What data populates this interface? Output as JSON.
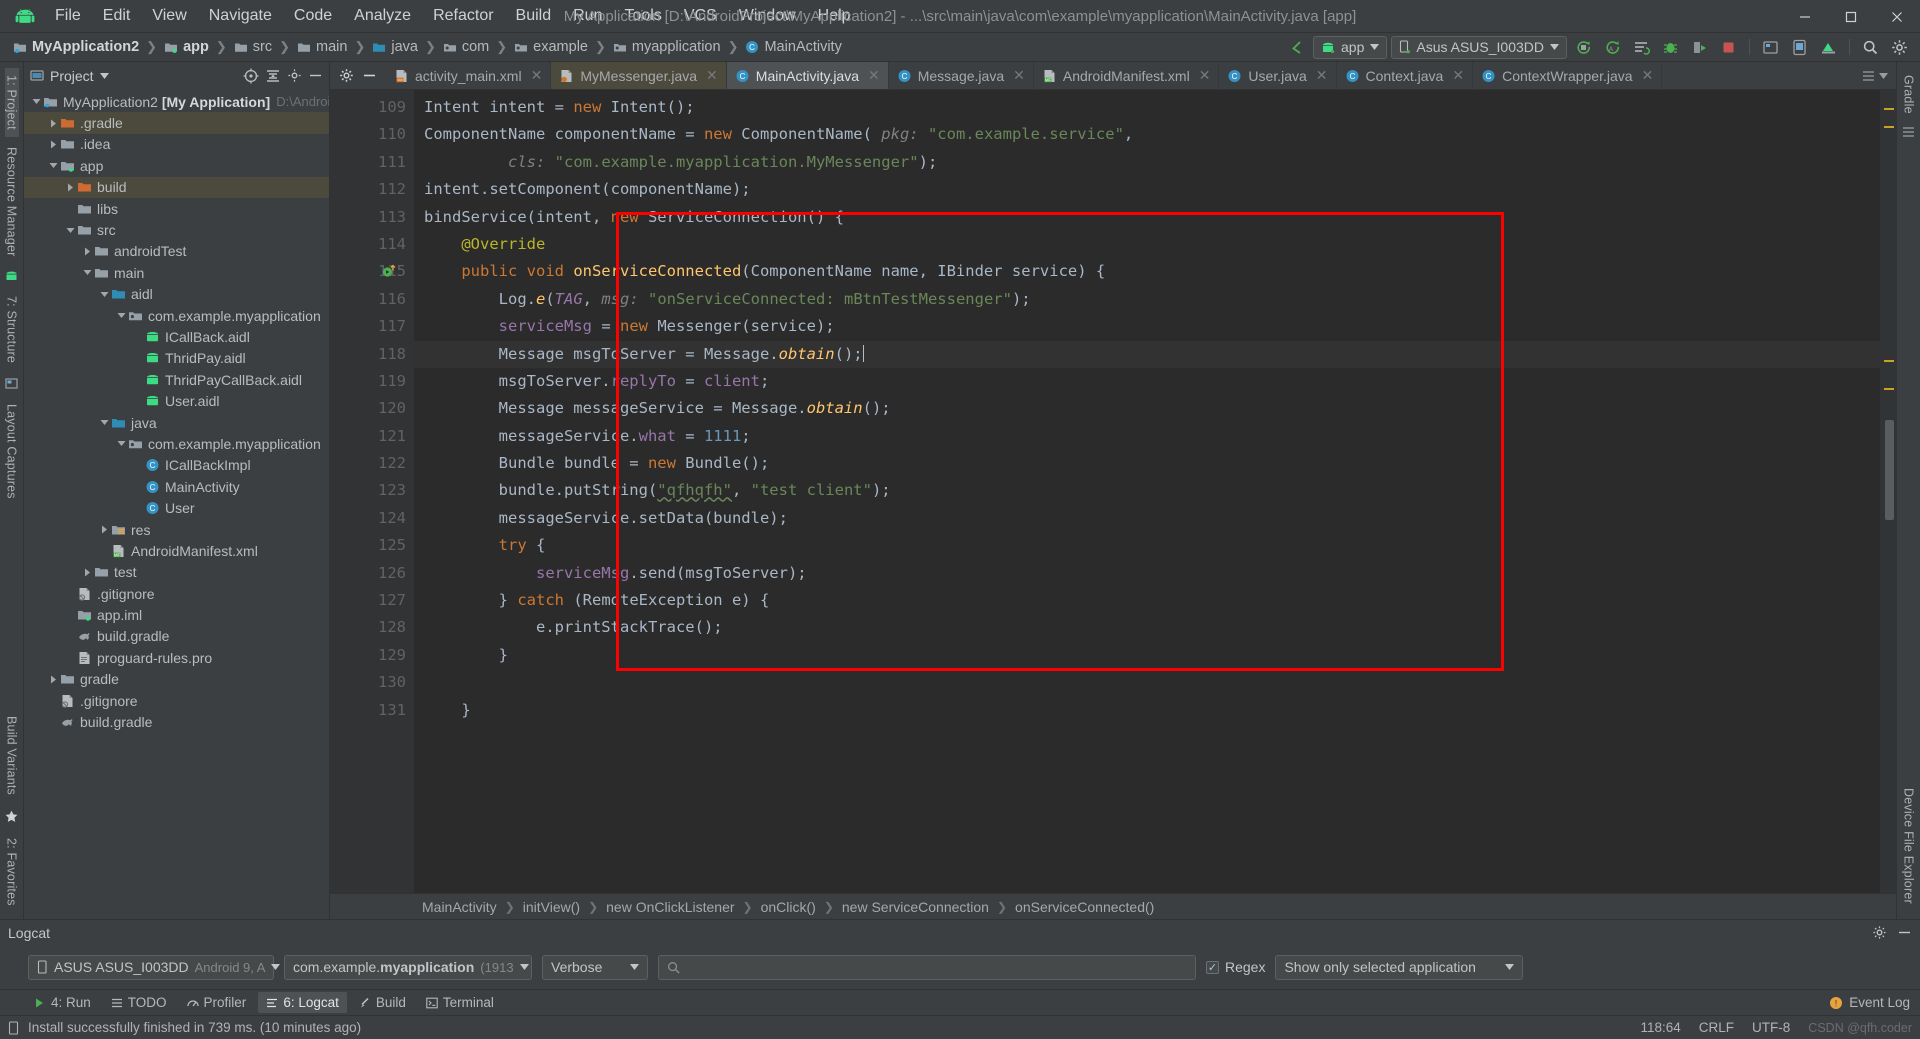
{
  "window": {
    "title": "My Application [D:\\AndroidProject\\MyApplication2] - ...\\src\\main\\java\\com\\example\\myapplication\\MainActivity.java [app]",
    "minimize": "—",
    "maximize": "❐",
    "close": "✕"
  },
  "menu": [
    {
      "label": "File"
    },
    {
      "label": "Edit"
    },
    {
      "label": "View"
    },
    {
      "label": "Navigate"
    },
    {
      "label": "Code"
    },
    {
      "label": "Analyze"
    },
    {
      "label": "Refactor"
    },
    {
      "label": "Build"
    },
    {
      "label": "Run"
    },
    {
      "label": "Tools"
    },
    {
      "label": "VCS"
    },
    {
      "label": "Window"
    },
    {
      "label": "Help"
    }
  ],
  "navbar": {
    "crumbs": [
      {
        "label": "MyApplication2",
        "icon": "project-folder-icon",
        "bold": true
      },
      {
        "label": "app",
        "icon": "module-folder-icon",
        "bold": true
      },
      {
        "label": "src",
        "icon": "folder-icon",
        "bold": false
      },
      {
        "label": "main",
        "icon": "folder-icon",
        "bold": false
      },
      {
        "label": "java",
        "icon": "source-folder-icon",
        "bold": false
      },
      {
        "label": "com",
        "icon": "package-icon",
        "bold": false
      },
      {
        "label": "example",
        "icon": "package-icon",
        "bold": false
      },
      {
        "label": "myapplication",
        "icon": "package-icon",
        "bold": false
      },
      {
        "label": "MainActivity",
        "icon": "class-icon",
        "bold": false
      }
    ],
    "run_config": "app",
    "device": "Asus ASUS_I003DD",
    "icons": [
      "back-arrow-icon",
      "run-icon",
      "debug-with-coverage-icon",
      "run-with-profiler-icon",
      "debug-icon",
      "attach-debugger-icon",
      "stop-icon",
      "layout-inspector-icon",
      "avd-manager-icon",
      "sdk-manager-icon",
      "search-icon",
      "settings-icon"
    ]
  },
  "left_rail": [
    {
      "label": "1: Project",
      "active": true
    },
    {
      "label": "Resource Manager",
      "active": false
    },
    {
      "label": "7: Structure",
      "active": false
    },
    {
      "label": "Layout Captures",
      "active": false
    },
    {
      "label": "Build Variants",
      "active": false
    },
    {
      "label": "2: Favorites",
      "active": false
    }
  ],
  "right_rail": [
    {
      "label": "Gradle"
    },
    {
      "label": "Device File Explorer"
    }
  ],
  "project_panel": {
    "title": "Project",
    "actions": [
      "target-icon",
      "collapse-all-icon",
      "settings-icon",
      "hide-icon"
    ],
    "tree": [
      {
        "depth": 0,
        "arrow": "down",
        "icon": "project-folder-icon",
        "label": "MyApplication2",
        "bold_suffix": "[My Application]",
        "sub": "D:\\Androi",
        "selected": false
      },
      {
        "depth": 1,
        "arrow": "right",
        "icon": "excluded-folder-icon",
        "label": ".gradle",
        "selected": true
      },
      {
        "depth": 1,
        "arrow": "right",
        "icon": "folder-icon",
        "label": ".idea",
        "selected": false
      },
      {
        "depth": 1,
        "arrow": "down",
        "icon": "module-folder-icon",
        "label": "app",
        "selected": false
      },
      {
        "depth": 2,
        "arrow": "right",
        "icon": "excluded-folder-icon",
        "label": "build",
        "selected": true
      },
      {
        "depth": 2,
        "arrow": "none",
        "icon": "folder-icon",
        "label": "libs",
        "selected": false
      },
      {
        "depth": 2,
        "arrow": "down",
        "icon": "folder-icon",
        "label": "src",
        "selected": false
      },
      {
        "depth": 3,
        "arrow": "right",
        "icon": "folder-icon",
        "label": "androidTest",
        "selected": false
      },
      {
        "depth": 3,
        "arrow": "down",
        "icon": "folder-icon",
        "label": "main",
        "selected": false
      },
      {
        "depth": 4,
        "arrow": "down",
        "icon": "source-folder-icon",
        "label": "aidl",
        "selected": false
      },
      {
        "depth": 5,
        "arrow": "down",
        "icon": "package-icon",
        "label": "com.example.myapplication",
        "selected": false
      },
      {
        "depth": 6,
        "arrow": "none",
        "icon": "aidl-file-icon",
        "label": "ICallBack.aidl",
        "selected": false
      },
      {
        "depth": 6,
        "arrow": "none",
        "icon": "aidl-file-icon",
        "label": "ThridPay.aidl",
        "selected": false
      },
      {
        "depth": 6,
        "arrow": "none",
        "icon": "aidl-file-icon",
        "label": "ThridPayCallBack.aidl",
        "selected": false
      },
      {
        "depth": 6,
        "arrow": "none",
        "icon": "aidl-file-icon",
        "label": "User.aidl",
        "selected": false
      },
      {
        "depth": 4,
        "arrow": "down",
        "icon": "source-folder-icon",
        "label": "java",
        "selected": false
      },
      {
        "depth": 5,
        "arrow": "down",
        "icon": "package-icon",
        "label": "com.example.myapplication",
        "selected": false
      },
      {
        "depth": 6,
        "arrow": "none",
        "icon": "class-icon",
        "label": "ICallBackImpl",
        "selected": false
      },
      {
        "depth": 6,
        "arrow": "none",
        "icon": "class-icon",
        "label": "MainActivity",
        "selected": false
      },
      {
        "depth": 6,
        "arrow": "none",
        "icon": "class-icon",
        "label": "User",
        "selected": false
      },
      {
        "depth": 4,
        "arrow": "right",
        "icon": "res-folder-icon",
        "label": "res",
        "selected": false
      },
      {
        "depth": 4,
        "arrow": "none",
        "icon": "manifest-file-icon",
        "label": "AndroidManifest.xml",
        "selected": false
      },
      {
        "depth": 3,
        "arrow": "right",
        "icon": "folder-icon",
        "label": "test",
        "selected": false
      },
      {
        "depth": 2,
        "arrow": "none",
        "icon": "gitignore-file-icon",
        "label": ".gitignore",
        "selected": false
      },
      {
        "depth": 2,
        "arrow": "none",
        "icon": "iml-file-icon",
        "label": "app.iml",
        "selected": false
      },
      {
        "depth": 2,
        "arrow": "none",
        "icon": "gradle-file-icon",
        "label": "build.gradle",
        "selected": false
      },
      {
        "depth": 2,
        "arrow": "none",
        "icon": "text-file-icon",
        "label": "proguard-rules.pro",
        "selected": false
      },
      {
        "depth": 1,
        "arrow": "right",
        "icon": "folder-icon",
        "label": "gradle",
        "selected": false
      },
      {
        "depth": 1,
        "arrow": "none",
        "icon": "gitignore-file-icon",
        "label": ".gitignore",
        "selected": false
      },
      {
        "depth": 1,
        "arrow": "none",
        "icon": "gradle-file-icon",
        "label": "build.gradle",
        "selected": false
      }
    ]
  },
  "editor_tabs": [
    {
      "label": "activity_main.xml",
      "icon": "xml-layout-file-icon",
      "state": "normal"
    },
    {
      "label": "MyMessenger.java",
      "icon": "java-file-icon",
      "state": "modified"
    },
    {
      "label": "MainActivity.java",
      "icon": "class-icon",
      "state": "active"
    },
    {
      "label": "Message.java",
      "icon": "class-icon",
      "state": "normal"
    },
    {
      "label": "AndroidManifest.xml",
      "icon": "manifest-file-icon",
      "state": "normal"
    },
    {
      "label": "User.java",
      "icon": "class-icon",
      "state": "normal"
    },
    {
      "label": "Context.java",
      "icon": "class-icon",
      "state": "normal"
    },
    {
      "label": "ContextWrapper.java",
      "icon": "class-icon",
      "state": "normal"
    }
  ],
  "editor": {
    "first_line": 109,
    "current_line": 118,
    "lines": [
      {
        "n": 109,
        "fold": false,
        "run": false,
        "tokens": [
          {
            "t": "Intent intent = ",
            "c": "p"
          },
          {
            "t": "new ",
            "c": "k"
          },
          {
            "t": "Intent();",
            "c": "p"
          }
        ],
        "indent": 0
      },
      {
        "n": 110,
        "fold": false,
        "run": false,
        "tokens": [
          {
            "t": "ComponentName componentName = ",
            "c": "p"
          },
          {
            "t": "new ",
            "c": "k"
          },
          {
            "t": "ComponentName(",
            "c": "p"
          },
          {
            "t": " pkg: ",
            "c": "hint"
          },
          {
            "t": "\"com.example.service\"",
            "c": "s"
          },
          {
            "t": ",",
            "c": "p"
          }
        ],
        "indent": 0
      },
      {
        "n": 111,
        "fold": false,
        "run": false,
        "tokens": [
          {
            "t": "        ",
            "c": "p"
          },
          {
            "t": " cls: ",
            "c": "hint"
          },
          {
            "t": "\"com.example.myapplication.MyMessenger\"",
            "c": "s"
          },
          {
            "t": ");",
            "c": "p"
          }
        ],
        "indent": 0
      },
      {
        "n": 112,
        "fold": false,
        "run": false,
        "tokens": [
          {
            "t": "intent.setComponent(componentName);",
            "c": "p"
          }
        ],
        "indent": 0
      },
      {
        "n": 113,
        "fold": true,
        "run": false,
        "tokens": [
          {
            "t": "bindService(intent, ",
            "c": "p"
          },
          {
            "t": "new ",
            "c": "k"
          },
          {
            "t": "ServiceConnection() {",
            "c": "p"
          }
        ],
        "indent": 0
      },
      {
        "n": 114,
        "fold": false,
        "run": false,
        "tokens": [
          {
            "t": "    @Override",
            "c": "an"
          }
        ],
        "indent": 0
      },
      {
        "n": 115,
        "fold": false,
        "run": true,
        "tokens": [
          {
            "t": "    ",
            "c": "p"
          },
          {
            "t": "public void ",
            "c": "k"
          },
          {
            "t": "onServiceConnected",
            "c": "f"
          },
          {
            "t": "(ComponentName name, IBinder service) {",
            "c": "p"
          }
        ],
        "indent": 0
      },
      {
        "n": 116,
        "fold": false,
        "run": false,
        "tokens": [
          {
            "t": "        Log.",
            "c": "p"
          },
          {
            "t": "e",
            "c": "f it"
          },
          {
            "t": "(",
            "c": "p"
          },
          {
            "t": "TAG",
            "c": "fld it"
          },
          {
            "t": ",",
            "c": "p"
          },
          {
            "t": " msg: ",
            "c": "hint"
          },
          {
            "t": "\"onServiceConnected: mBtnTestMessenger\"",
            "c": "s"
          },
          {
            "t": ");",
            "c": "p"
          }
        ],
        "indent": 0
      },
      {
        "n": 117,
        "fold": false,
        "run": false,
        "tokens": [
          {
            "t": "        ",
            "c": "p"
          },
          {
            "t": "serviceMsg",
            "c": "fld"
          },
          {
            "t": " = ",
            "c": "p"
          },
          {
            "t": "new ",
            "c": "k"
          },
          {
            "t": "Messenger(service);",
            "c": "p"
          }
        ],
        "indent": 0
      },
      {
        "n": 118,
        "fold": false,
        "run": false,
        "tokens": [
          {
            "t": "        Message msgToServer = Message.",
            "c": "p"
          },
          {
            "t": "obtain",
            "c": "f it"
          },
          {
            "t": "();",
            "c": "p"
          }
        ],
        "indent": 0,
        "caret": true
      },
      {
        "n": 119,
        "fold": false,
        "run": false,
        "tokens": [
          {
            "t": "        msgToServer.",
            "c": "p"
          },
          {
            "t": "replyTo",
            "c": "fld"
          },
          {
            "t": " = ",
            "c": "p"
          },
          {
            "t": "client",
            "c": "fld"
          },
          {
            "t": ";",
            "c": "p"
          }
        ],
        "indent": 0
      },
      {
        "n": 120,
        "fold": false,
        "run": false,
        "tokens": [
          {
            "t": "        Message messageService = Message.",
            "c": "p"
          },
          {
            "t": "obtain",
            "c": "f it"
          },
          {
            "t": "();",
            "c": "p"
          }
        ],
        "indent": 0
      },
      {
        "n": 121,
        "fold": false,
        "run": false,
        "tokens": [
          {
            "t": "        messageService.",
            "c": "p"
          },
          {
            "t": "what",
            "c": "fld"
          },
          {
            "t": " = ",
            "c": "p"
          },
          {
            "t": "1111",
            "c": "n"
          },
          {
            "t": ";",
            "c": "p"
          }
        ],
        "indent": 0
      },
      {
        "n": 122,
        "fold": false,
        "run": false,
        "tokens": [
          {
            "t": "        Bundle bundle = ",
            "c": "p"
          },
          {
            "t": "new ",
            "c": "k"
          },
          {
            "t": "Bundle();",
            "c": "p"
          }
        ],
        "indent": 0
      },
      {
        "n": 123,
        "fold": false,
        "run": false,
        "tokens": [
          {
            "t": "        bundle.putString(",
            "c": "p"
          },
          {
            "t": "\"qfhqfh\"",
            "c": "s typo"
          },
          {
            "t": ", ",
            "c": "p"
          },
          {
            "t": "\"test client\"",
            "c": "s"
          },
          {
            "t": ");",
            "c": "p"
          }
        ],
        "indent": 0
      },
      {
        "n": 124,
        "fold": false,
        "run": false,
        "tokens": [
          {
            "t": "        messageService.setData(bundle);",
            "c": "p"
          }
        ],
        "indent": 0
      },
      {
        "n": 125,
        "fold": true,
        "run": false,
        "tokens": [
          {
            "t": "        ",
            "c": "p"
          },
          {
            "t": "try ",
            "c": "k"
          },
          {
            "t": "{",
            "c": "p"
          }
        ],
        "indent": 0
      },
      {
        "n": 126,
        "fold": false,
        "run": false,
        "tokens": [
          {
            "t": "            ",
            "c": "p"
          },
          {
            "t": "serviceMsg",
            "c": "fld"
          },
          {
            "t": ".send(msgToServer);",
            "c": "p"
          }
        ],
        "indent": 0
      },
      {
        "n": 127,
        "fold": true,
        "run": false,
        "tokens": [
          {
            "t": "        } ",
            "c": "p"
          },
          {
            "t": "catch ",
            "c": "k"
          },
          {
            "t": "(RemoteException e) {",
            "c": "p"
          }
        ],
        "indent": 0
      },
      {
        "n": 128,
        "fold": false,
        "run": false,
        "tokens": [
          {
            "t": "            e.printStackTrace();",
            "c": "p"
          }
        ],
        "indent": 0
      },
      {
        "n": 129,
        "fold": true,
        "run": false,
        "tokens": [
          {
            "t": "        }",
            "c": "p"
          }
        ],
        "indent": 0
      },
      {
        "n": 130,
        "fold": false,
        "run": false,
        "tokens": [
          {
            "t": "",
            "c": "p"
          }
        ],
        "indent": 0
      },
      {
        "n": 131,
        "fold": true,
        "run": false,
        "tokens": [
          {
            "t": "    }",
            "c": "p"
          }
        ],
        "indent": 0
      }
    ],
    "breadcrumbs": [
      "MainActivity",
      "initView()",
      "new OnClickListener",
      "onClick()",
      "new ServiceConnection",
      "onServiceConnected()"
    ]
  },
  "logcat": {
    "title": "Logcat",
    "device": "ASUS ASUS_I003DD",
    "device_sub": "Android 9, A",
    "process": "com.example.",
    "process_bold": "myapplication",
    "process_pid": "(1913",
    "level": "Verbose",
    "search_placeholder": "",
    "regex_label": "Regex",
    "regex_checked": true,
    "filter": "Show only selected application"
  },
  "bottom_tools": [
    {
      "label": "4: Run",
      "icon": "run-icon",
      "active": false
    },
    {
      "label": "TODO",
      "icon": "todo-icon",
      "active": false
    },
    {
      "label": "Profiler",
      "icon": "profiler-icon",
      "active": false
    },
    {
      "label": "6: Logcat",
      "icon": "logcat-icon",
      "active": true
    },
    {
      "label": "Build",
      "icon": "build-icon",
      "active": false
    },
    {
      "label": "Terminal",
      "icon": "terminal-icon",
      "active": false
    }
  ],
  "event_log": "Event Log",
  "statusbar": {
    "message": "Install successfully finished in 739 ms. (10 minutes ago)",
    "caret_position": "118:64",
    "line_separator": "CRLF",
    "encoding": "UTF-8",
    "watermark": "CSDN @qfh.coder"
  },
  "colors": {
    "accent_red": "#ff0000",
    "android_green": "#3ddc84",
    "tab_active_bg": "#4e5254",
    "selection_olive": "#4c4a3d",
    "editor_bg": "#2b2b2b",
    "chrome_bg": "#3c3f41"
  }
}
